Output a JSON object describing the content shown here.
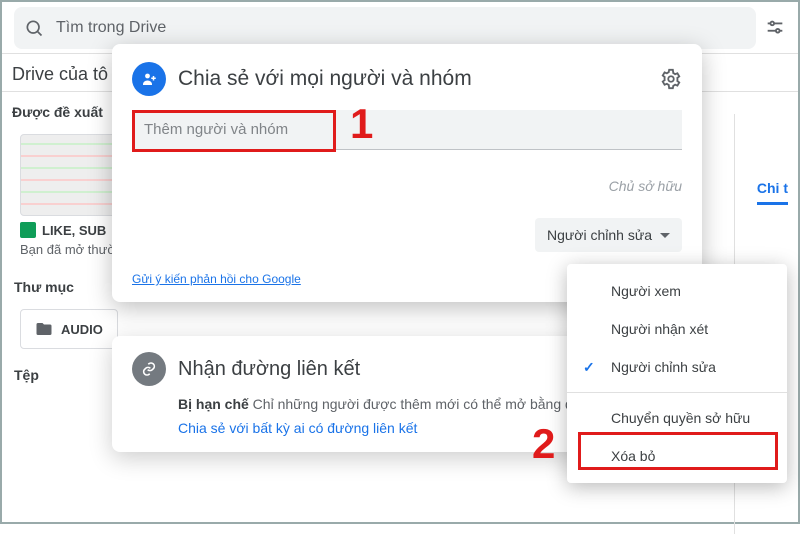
{
  "topbar": {
    "search_placeholder": "Tìm trong Drive"
  },
  "bg": {
    "drive_title": "Drive của tô",
    "suggested": "Được đề xuất",
    "file_name": "LIKE, SUB",
    "file_sub": "Bạn đã mở thườ",
    "folders_label": "Thư mục",
    "folder_name": "AUDIO",
    "files_label": "Tệp",
    "right_tab": "Chi t"
  },
  "share": {
    "title": "Chia sẻ với mọi người và nhóm",
    "add_placeholder": "Thêm người và nhóm",
    "owner": "Chủ sở hữu",
    "role_button": "Người chỉnh sửa",
    "feedback": "Gửi ý kiến phản hồi cho Google"
  },
  "menu": {
    "viewer": "Người xem",
    "commenter": "Người nhận xét",
    "editor": "Người chỉnh sửa",
    "transfer": "Chuyển quyền sở hữu",
    "remove": "Xóa bỏ"
  },
  "link": {
    "title": "Nhận đường liên kết",
    "restricted_b": "Bị hạn chế",
    "restricted_rest": " Chỉ những người được thêm mới có thể mở bằng đường liên kết này",
    "change": "Chia sẻ với bất kỳ ai có đường liên kết"
  },
  "anno": {
    "n1": "1",
    "n2": "2"
  }
}
